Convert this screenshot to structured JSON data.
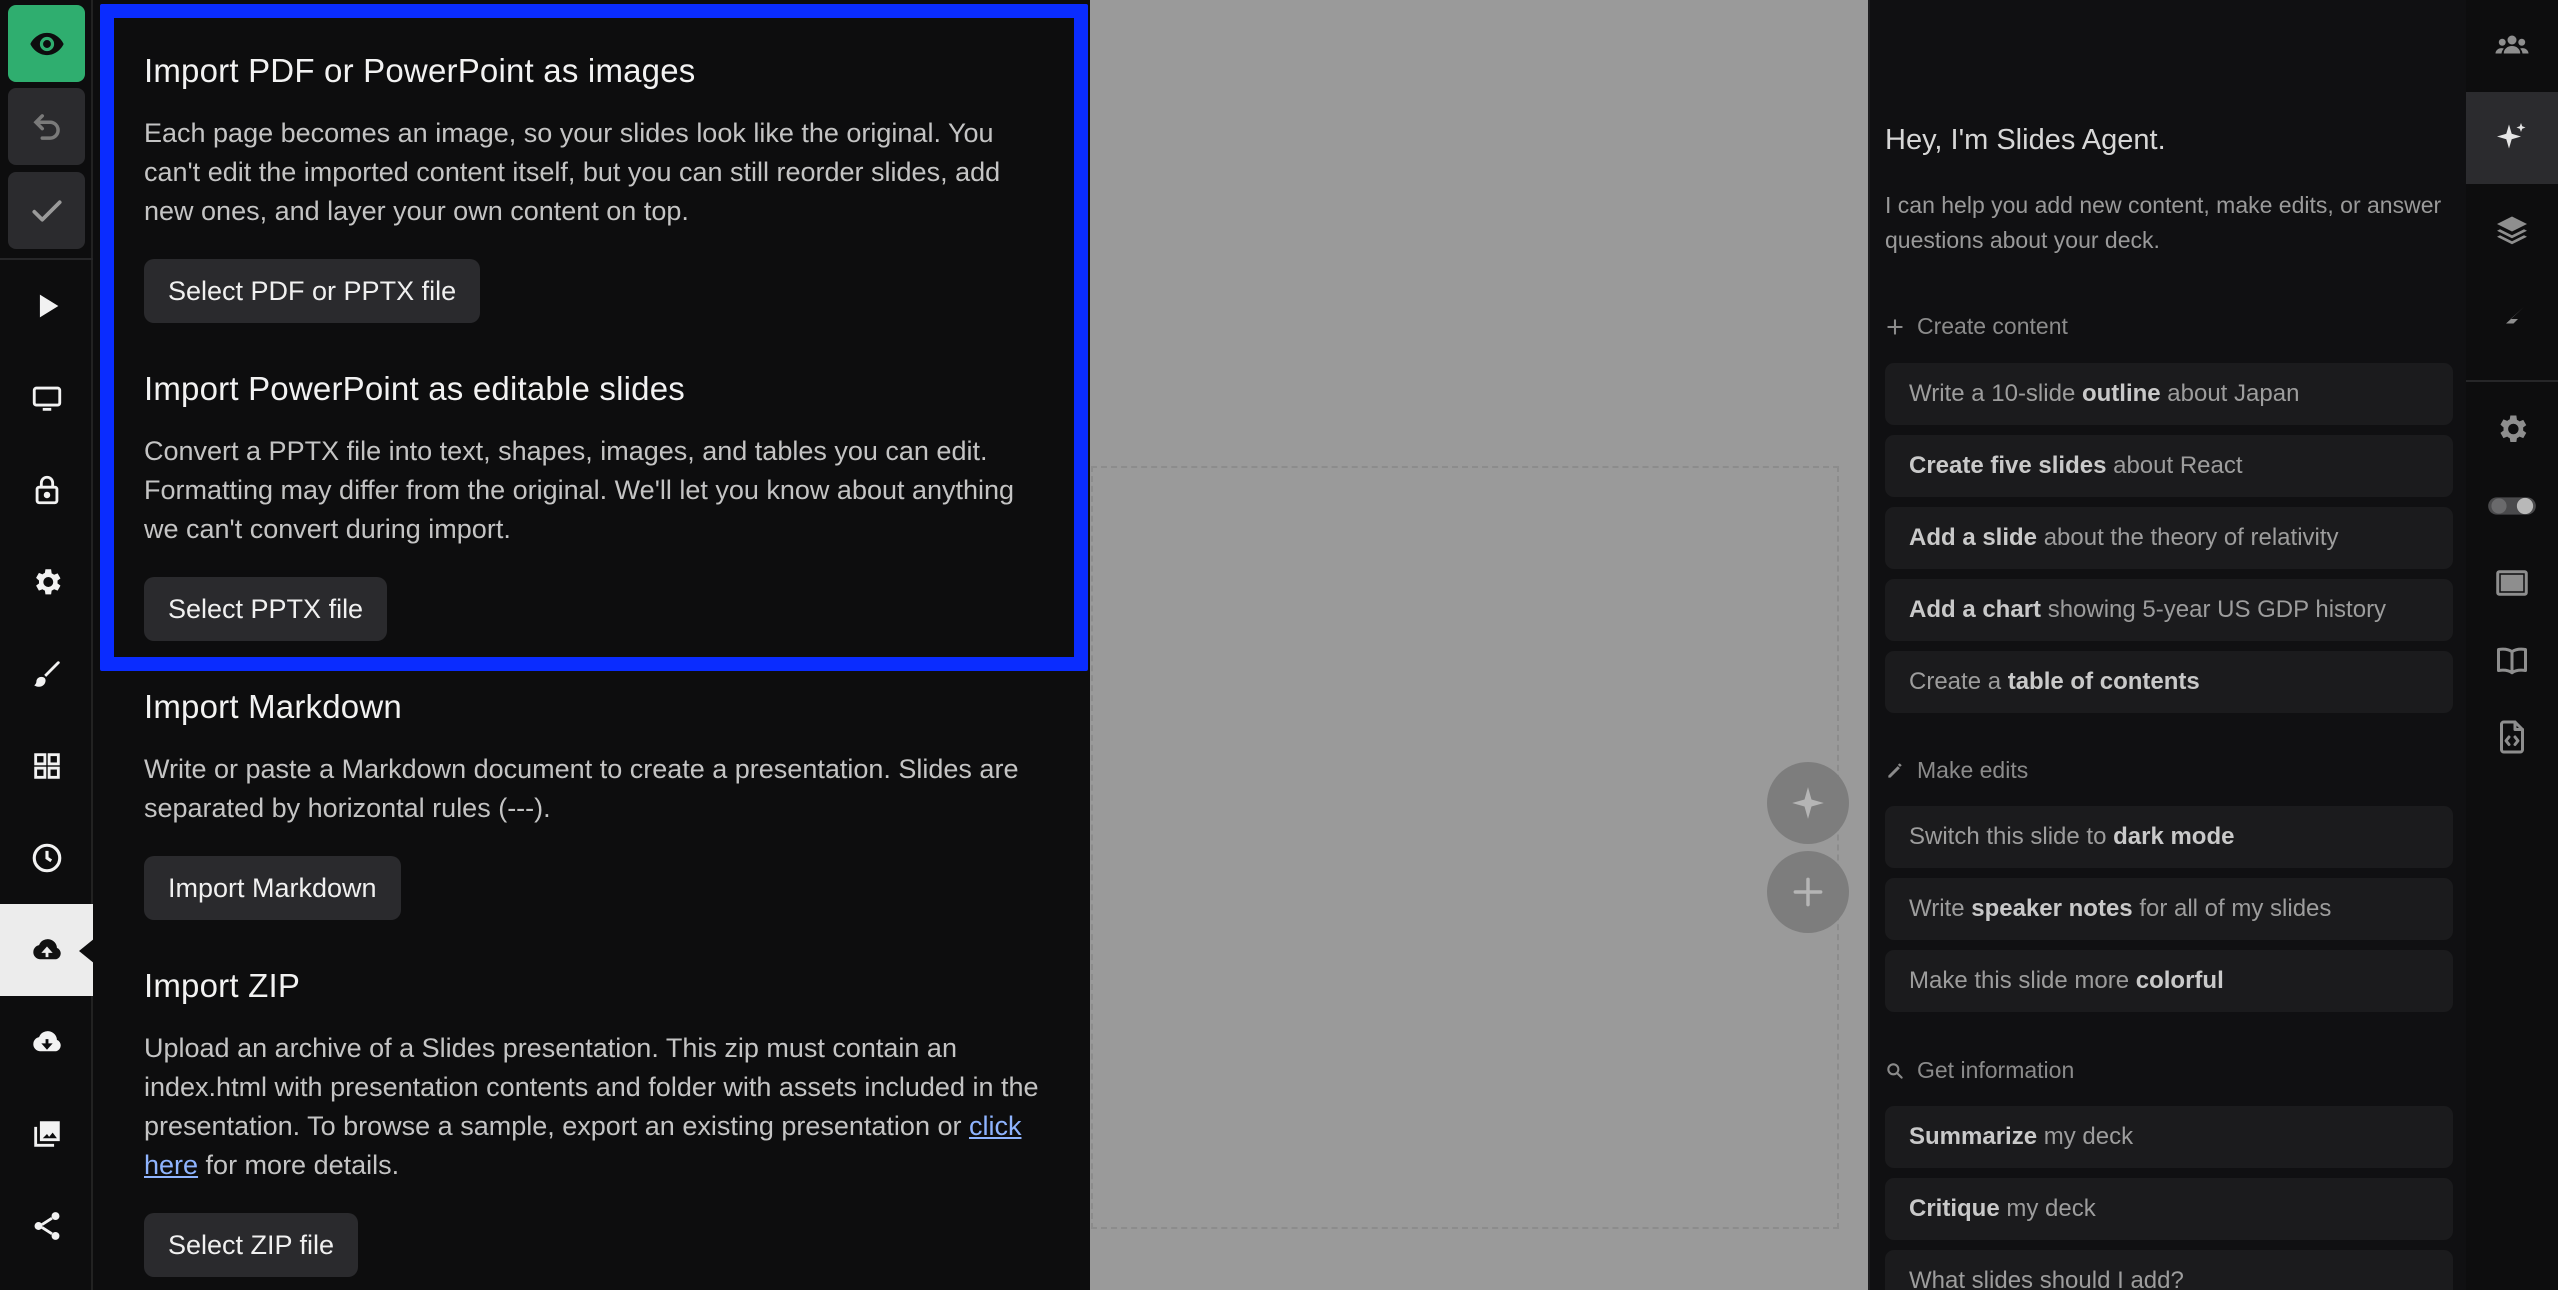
{
  "import_panel": {
    "sections": [
      {
        "title": "Import PDF or PowerPoint as images",
        "body": "Each page becomes an image, so your slides look like the original. You can't edit the imported content itself, but you can still reorder slides, add new ones, and layer your own content on top.",
        "button": "Select PDF or PPTX file"
      },
      {
        "title": "Import PowerPoint as editable slides",
        "body": "Convert a PPTX file into text, shapes, images, and tables you can edit. Formatting may differ from the original. We'll let you know about anything we can't convert during import.",
        "button": "Select PPTX file"
      },
      {
        "title": "Import Markdown",
        "body": "Write or paste a Markdown document to create a presentation. Slides are separated by horizontal rules (---).",
        "button": "Import Markdown"
      },
      {
        "title": "Import ZIP",
        "body_before_link": "Upload an archive of a Slides presentation. This zip must contain an index.html with presentation contents and folder with assets included in the presentation. To browse a sample, export an existing presentation or ",
        "link": "click here",
        "body_after_link": " for more details.",
        "button": "Select ZIP file"
      }
    ]
  },
  "agent": {
    "title": "Hey, I'm Slides Agent.",
    "subtitle": "I can help you add new content, make edits, or answer questions about your deck.",
    "groups": {
      "create": {
        "label": "Create content",
        "items": [
          {
            "pre": "Write a 10-slide ",
            "bold": "outline",
            "post": " about Japan"
          },
          {
            "pre": "",
            "bold": "Create five slides",
            "post": " about React"
          },
          {
            "pre": "",
            "bold": "Add a slide",
            "post": " about the theory of relativity"
          },
          {
            "pre": "",
            "bold": "Add a chart",
            "post": " showing 5-year US GDP history"
          },
          {
            "pre": "Create a ",
            "bold": "table of contents",
            "post": ""
          }
        ]
      },
      "edit": {
        "label": "Make edits",
        "items": [
          {
            "pre": "Switch this slide to ",
            "bold": "dark mode",
            "post": ""
          },
          {
            "pre": "Write ",
            "bold": "speaker notes",
            "post": " for all of my slides"
          },
          {
            "pre": "Make this slide more ",
            "bold": "colorful",
            "post": ""
          }
        ]
      },
      "info": {
        "label": "Get information",
        "items": [
          {
            "pre": "",
            "bold": "Summarize",
            "post": " my deck"
          },
          {
            "pre": "",
            "bold": "Critique",
            "post": " my deck"
          },
          {
            "pre": "What slides should I add?",
            "bold": "",
            "post": ""
          }
        ]
      }
    }
  },
  "icons": {
    "left": [
      "eye-icon",
      "undo-icon",
      "check-icon",
      "play-icon",
      "monitor-icon",
      "lock-icon",
      "gear-icon",
      "brush-icon",
      "grid-icon",
      "clock-icon",
      "cloud-upload-icon",
      "cloud-download-icon",
      "image-icon",
      "share-icon"
    ],
    "right": [
      "users-icon",
      "sparkle-icon",
      "layers-icon",
      "lightning-icon",
      "gear-icon",
      "toggle-icon",
      "slide-frame-icon",
      "book-icon",
      "code-file-icon"
    ]
  },
  "colors": {
    "accent_green": "#2fae6f",
    "highlight_blue": "#0a2cff",
    "canvas_gray": "#9a9a9a"
  }
}
